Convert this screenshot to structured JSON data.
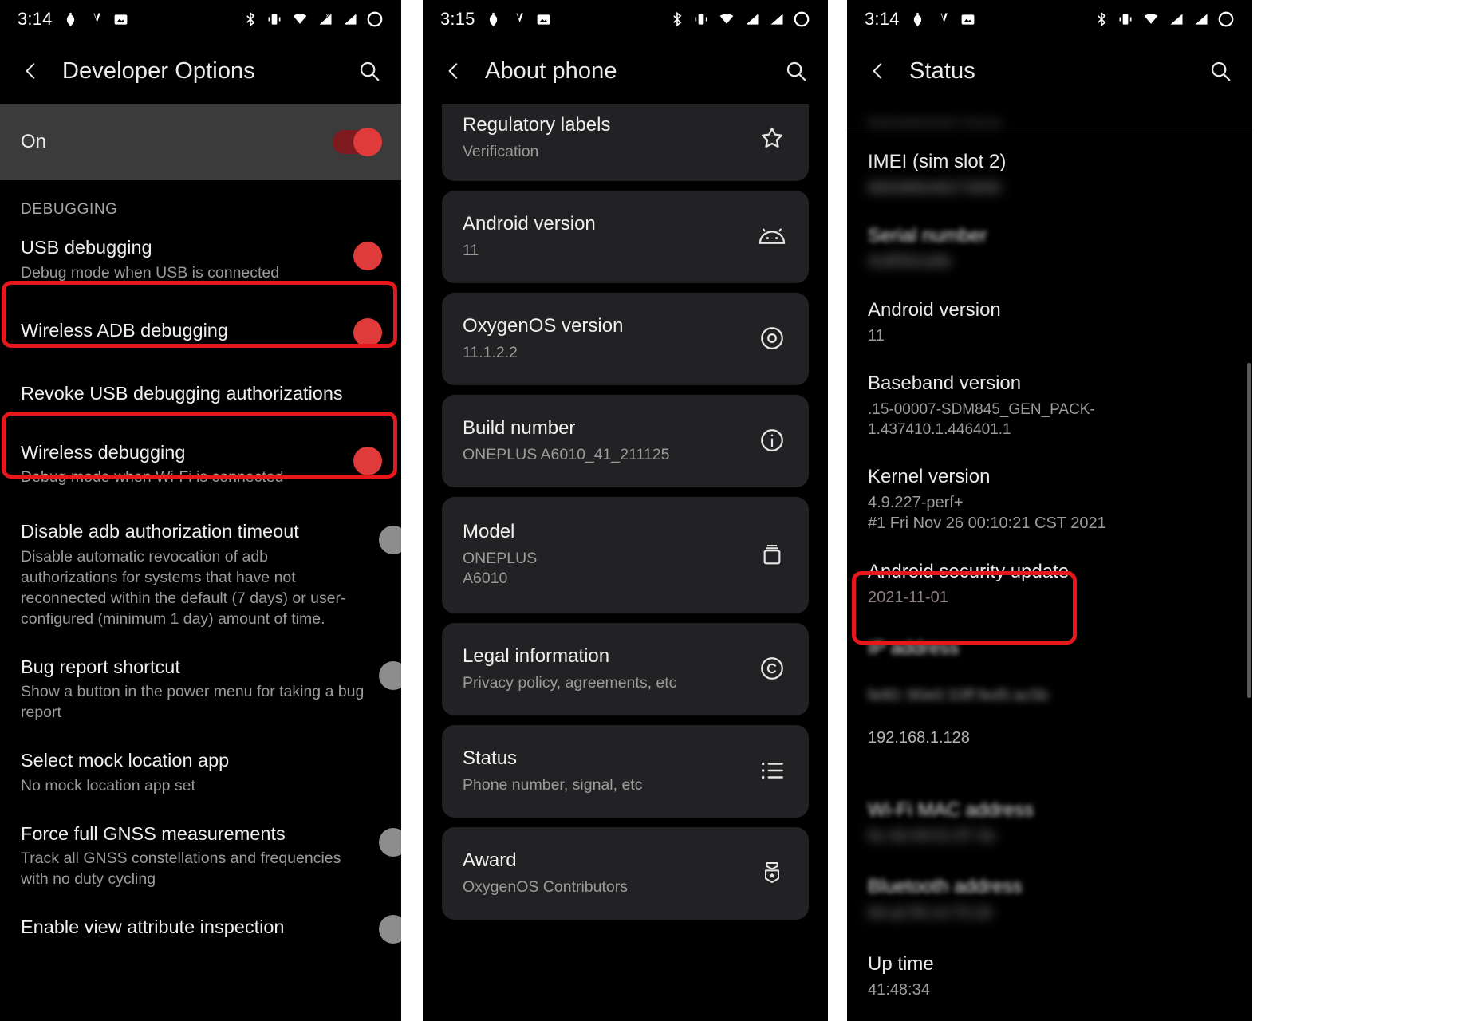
{
  "panels": [
    {
      "status_bar": {
        "time": "3:14"
      },
      "appbar": {
        "title": "Developer Options"
      },
      "master_toggle": {
        "label": "On",
        "state": "on"
      },
      "section_header": "DEBUGGING",
      "rows": [
        {
          "title": "USB debugging",
          "sub": "Debug mode when USB is connected",
          "control": "switch",
          "state": "on",
          "highlighted": false
        },
        {
          "title": "Wireless ADB debugging",
          "sub": "",
          "control": "switch",
          "state": "on",
          "highlighted": true
        },
        {
          "title": "Revoke USB debugging authorizations",
          "sub": "",
          "control": "none",
          "state": "",
          "highlighted": false
        },
        {
          "title": "Wireless debugging",
          "sub": "Debug mode when Wi-Fi is connected",
          "control": "switch",
          "state": "on",
          "highlighted": true
        },
        {
          "title": "Disable adb authorization timeout",
          "sub": "Disable automatic revocation of adb authorizations for systems that have not reconnected within the default (7 days) or user-configured (minimum 1 day) amount of time.",
          "control": "switch",
          "state": "off",
          "highlighted": false
        },
        {
          "title": "Bug report shortcut",
          "sub": "Show a button in the power menu for taking a bug report",
          "control": "switch",
          "state": "off",
          "highlighted": false
        },
        {
          "title": "Select mock location app",
          "sub": "No mock location app set",
          "control": "none",
          "state": "",
          "highlighted": false
        },
        {
          "title": "Force full GNSS measurements",
          "sub": "Track all GNSS constellations and frequencies with no duty cycling",
          "control": "switch",
          "state": "off",
          "highlighted": false
        },
        {
          "title": "Enable view attribute inspection",
          "sub": "",
          "control": "switch",
          "state": "off",
          "highlighted": false
        }
      ]
    },
    {
      "status_bar": {
        "time": "3:15"
      },
      "appbar": {
        "title": "About phone"
      },
      "cards": [
        {
          "title": "Regulatory labels",
          "sub": "Verification",
          "icon": "star-icon"
        },
        {
          "title": "Android version",
          "sub": "11",
          "icon": "android-icon"
        },
        {
          "title": "OxygenOS version",
          "sub": "11.1.2.2",
          "icon": "target-circle-icon"
        },
        {
          "title": "Build number",
          "sub": "ONEPLUS A6010_41_211125",
          "icon": "info-icon"
        },
        {
          "title": "Model",
          "sub": "ONEPLUS\nA6010",
          "icon": "device-box-icon"
        },
        {
          "title": "Legal information",
          "sub": "Privacy policy, agreements, etc",
          "icon": "copyright-icon"
        },
        {
          "title": "Status",
          "sub": "Phone number, signal, etc",
          "icon": "list-icon"
        },
        {
          "title": "Award",
          "sub": "OxygenOS Contributors",
          "icon": "medal-icon"
        }
      ]
    },
    {
      "status_bar": {
        "time": "3:14"
      },
      "appbar": {
        "title": "Status"
      },
      "rows": [
        {
          "title": "",
          "value": "869386048273018",
          "blur": "hard",
          "highlighted": false
        },
        {
          "title": "IMEI (sim slot 2)",
          "value": "869386048273000",
          "blur": "hard",
          "highlighted": false
        },
        {
          "title": "Serial number",
          "value": "4c8f2b1a9e",
          "blur": "hard",
          "highlighted": false
        },
        {
          "title": "Android version",
          "value": "11",
          "blur": "none",
          "highlighted": false
        },
        {
          "title": "Baseband version",
          "value": ".15-00007-SDM845_GEN_PACK-1.437410.1.446401.1",
          "blur": "none",
          "highlighted": false
        },
        {
          "title": "Kernel version",
          "value": "4.9.227-perf+\n#1 Fri Nov 26 00:10:21 CST 2021",
          "blur": "none",
          "highlighted": false
        },
        {
          "title": "Android security update",
          "value": "2021-11-01",
          "blur": "none",
          "highlighted": false
        },
        {
          "title": "IP address",
          "value": "fe80::90e0:33ff:fed5:ac5b\n192.168.1.128",
          "blur": "partial",
          "highlighted": true
        },
        {
          "title": "Wi-Fi MAC address",
          "value": "6c:4d:49:01:87:3e",
          "blur": "hard",
          "highlighted": false
        },
        {
          "title": "Bluetooth address",
          "value": "64:a2:f9:14:75:20",
          "blur": "hard",
          "highlighted": false
        },
        {
          "title": "Up time",
          "value": "41:48:34",
          "blur": "none",
          "highlighted": false
        }
      ]
    }
  ],
  "colors": {
    "highlight": "#e8171c",
    "accent_toggle": "#e03b3b",
    "card_bg": "#222224",
    "page_bg": "#000000"
  },
  "icons": {
    "back": "chevron-left-icon",
    "search": "search-icon",
    "status_bar": [
      "alarm-icon",
      "vpn-icon",
      "screenshot-icon",
      "bluetooth-icon",
      "vibrate-icon",
      "wifi-icon",
      "signal-1-icon",
      "signal-2-icon",
      "battery-icon"
    ]
  }
}
